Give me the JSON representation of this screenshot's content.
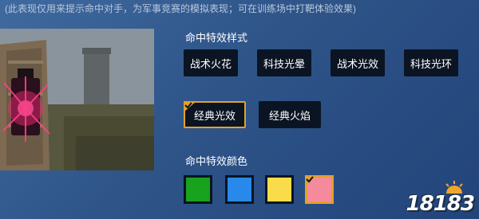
{
  "note": "(此表现仅用来提示命中对手，为军事竞赛的模拟表现；可在训练场中打靶体验效果)",
  "hit_style": {
    "title": "命中特效样式",
    "options": [
      "战术火花",
      "科技光晕",
      "战术光效",
      "科技光环"
    ],
    "options_row2": [
      "经典光效",
      "经典火焰"
    ],
    "selected": "经典光效"
  },
  "hit_color": {
    "title": "命中特效颜色",
    "swatches": [
      "#18a21e",
      "#2889ea",
      "#f8dc4a",
      "#f58a9c"
    ],
    "selected_index": 3
  },
  "accent_color": "#e3a12b",
  "watermark": "18183"
}
